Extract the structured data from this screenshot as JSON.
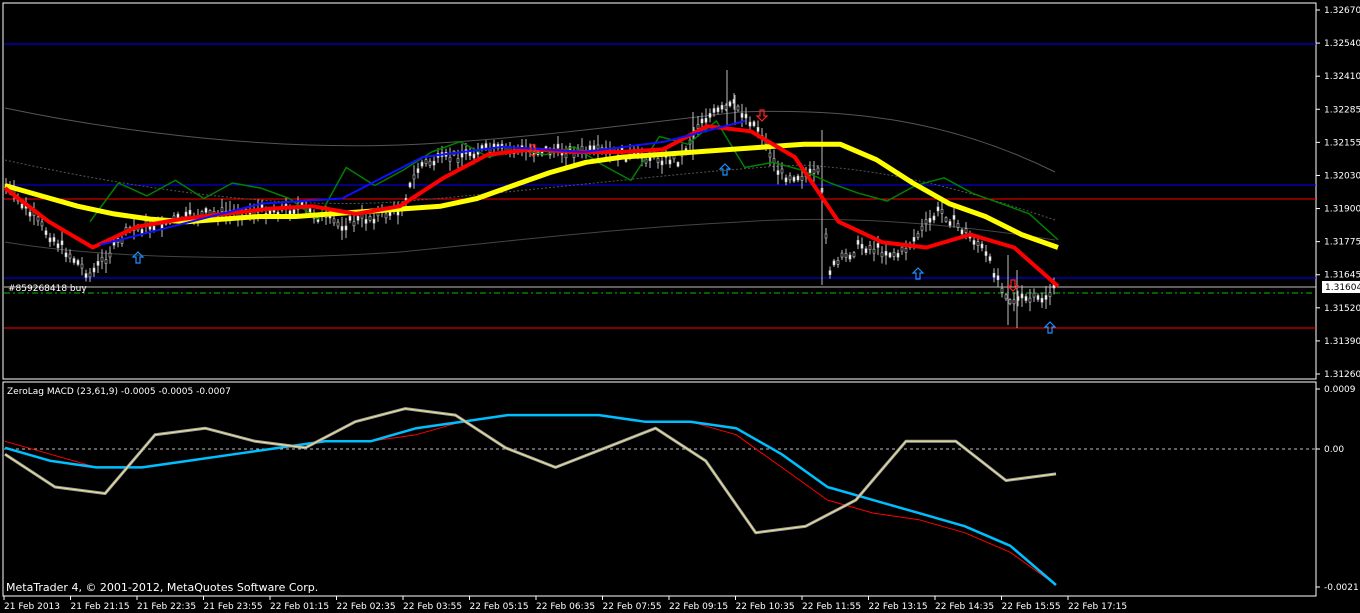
{
  "app": {
    "copyright": "MetaTrader 4, © 2001-2012, MetaQuotes Software Corp."
  },
  "colors": {
    "background": "#000000",
    "frame": "#ffffff",
    "candle": "#c0c0c0",
    "ema_fast": "#ff0000",
    "ema_fast_lower": "#ff88b0",
    "ema_blue": "#1010ff",
    "ema_slow": "#ffff00",
    "oscillator": "#008000",
    "envelope": "#555555",
    "support": "#0000ff",
    "resistance": "#ff0000",
    "order_line": "#00c000",
    "buy_arrow": "#1e90ff",
    "sell_arrow": "#ff2020",
    "macd_main": "#00bfff",
    "macd_signal": "#ff0000",
    "macd_fast": "#f0e68c",
    "macd_fast2": "#a0a0a0"
  },
  "order": {
    "label": "#859268418 buy",
    "price_label": "1.3160"
  },
  "main_chart": {
    "price_ticks": [
      "1.32670",
      "1.32540",
      "1.32410",
      "1.32285",
      "1.32155",
      "1.32030",
      "1.31900",
      "1.31775",
      "1.31645",
      "1.31520",
      "1.31390",
      "1.31260"
    ],
    "current_price": "1.31604",
    "ylim": [
      1.3126,
      1.3267
    ]
  },
  "macd": {
    "label": "ZeroLag MACD (23,61,9) -0.0005 -0.0005 -0.0007",
    "ticks": [
      "0.0009",
      "0.00",
      "-0.0021"
    ],
    "ylim": [
      -0.0021,
      0.0009
    ]
  },
  "time_axis": {
    "labels": [
      "21 Feb 2013",
      "21 Feb 21:15",
      "21 Feb 22:35",
      "21 Feb 23:55",
      "22 Feb 01:15",
      "22 Feb 02:35",
      "22 Feb 03:55",
      "22 Feb 05:15",
      "22 Feb 06:35",
      "22 Feb 07:55",
      "22 Feb 09:15",
      "22 Feb 10:35",
      "22 Feb 11:55",
      "22 Feb 13:15",
      "22 Feb 14:35",
      "22 Feb 15:55",
      "22 Feb 17:15"
    ]
  },
  "chart_data": {
    "type": "line",
    "x_label_count": 17,
    "series": [
      {
        "key": "ema_slow",
        "values": [
          1.3199,
          1.3195,
          1.3191,
          1.3188,
          1.3186,
          1.3185,
          1.3186,
          1.3187,
          1.3187,
          1.3188,
          1.3189,
          1.319,
          1.3191,
          1.3194,
          1.3199,
          1.3204,
          1.3208,
          1.321,
          1.3211,
          1.3212,
          1.3213,
          1.3214,
          1.3215,
          1.3215,
          1.3209,
          1.32,
          1.3192,
          1.3187,
          1.318,
          1.3175
        ]
      },
      {
        "key": "ema_fast",
        "values": [
          1.3198,
          1.3185,
          1.3175,
          1.3183,
          1.3186,
          1.3188,
          1.319,
          1.3191,
          1.3188,
          1.3191,
          1.3202,
          1.3211,
          1.3213,
          1.3212,
          1.3212,
          1.3213,
          1.3222,
          1.322,
          1.321,
          1.3185,
          1.3177,
          1.3175,
          1.318,
          1.3175,
          1.316
        ]
      },
      {
        "key": "ema_blue",
        "values": [
          1.3176,
          1.3184,
          1.3192,
          1.3194,
          1.321,
          1.3214,
          1.3212,
          1.3216,
          1.3224
        ]
      },
      {
        "key": "oscillator",
        "values": [
          1.3185,
          1.32,
          1.3195,
          1.3201,
          1.3194,
          1.32,
          1.3198,
          1.3194,
          1.3186,
          1.3206,
          1.3199,
          1.3205,
          1.3212,
          1.3216,
          1.321,
          1.3213,
          1.3211,
          1.3214,
          1.3207,
          1.3201,
          1.3218,
          1.3215,
          1.3224,
          1.3206,
          1.3208,
          1.3205,
          1.32,
          1.3196,
          1.3193,
          1.3199,
          1.3202,
          1.3196,
          1.3192,
          1.3188,
          1.3178
        ]
      },
      {
        "key": "macd_main",
        "values": [
          0.0,
          -0.0002,
          -0.0003,
          -0.0003,
          -0.0002,
          -0.0001,
          0.0,
          0.0001,
          0.0001,
          0.0003,
          0.0004,
          0.0005,
          0.0005,
          0.0005,
          0.0004,
          0.0004,
          0.0003,
          -0.0001,
          -0.0006,
          -0.0008,
          -0.001,
          -0.0012,
          -0.0015,
          -0.0021
        ]
      },
      {
        "key": "macd_signal",
        "values": [
          0.0001,
          -0.0001,
          -0.0003,
          -0.0003,
          -0.0002,
          -0.0001,
          0.0,
          0.0001,
          0.0001,
          0.0002,
          0.0004,
          0.0005,
          0.0005,
          0.0005,
          0.0004,
          0.0004,
          0.0002,
          -0.0003,
          -0.0008,
          -0.001,
          -0.0011,
          -0.0013,
          -0.0016,
          -0.0021
        ]
      },
      {
        "key": "macd_fast",
        "values": [
          -0.0001,
          -0.0006,
          -0.0007,
          0.0002,
          0.0003,
          0.0001,
          0.0,
          0.0004,
          0.0006,
          0.0005,
          0.0,
          -0.0003,
          0.0,
          0.0003,
          -0.0002,
          -0.0013,
          -0.0012,
          -0.0008,
          0.0001,
          0.0001,
          -0.0005,
          -0.0004
        ]
      }
    ]
  }
}
